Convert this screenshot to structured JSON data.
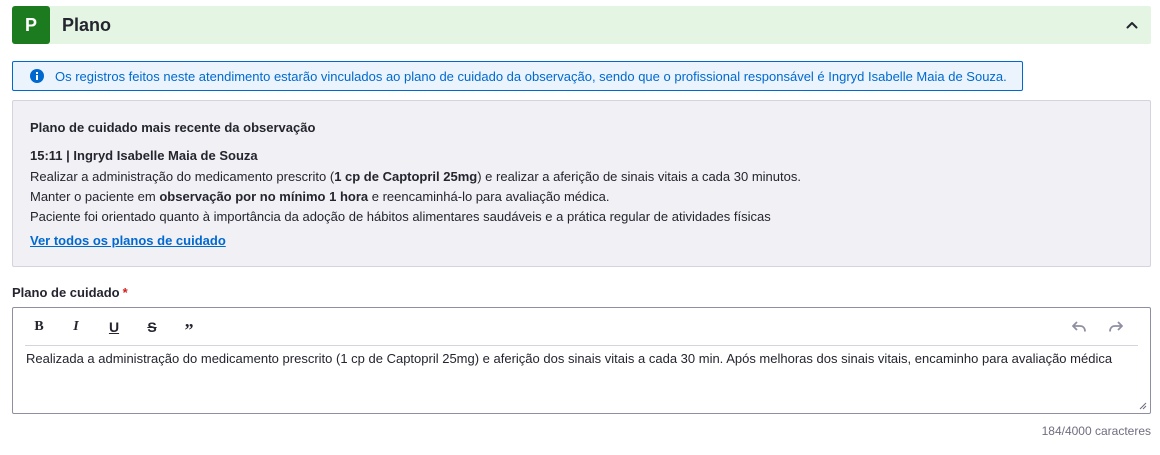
{
  "section": {
    "badge": "P",
    "title": "Plano",
    "collapse_icon": "chevron-up-icon",
    "badge_color": "#1d7b1f",
    "header_bg": "#e4f5e4"
  },
  "alert": {
    "icon": "info-icon",
    "text": "Os registros feitos neste atendimento estarão vinculados ao plano de cuidado da observação, sendo que o profissional responsável é Ingryd Isabelle Maia de Souza.",
    "color": "#0069d0"
  },
  "recent_plan": {
    "heading": "Plano de cuidado mais recente da observação",
    "entry_header": "15:11 | Ingryd Isabelle Maia de Souza",
    "line1": {
      "pre": "Realizar a administração do medicamento prescrito (",
      "bold": "1 cp de Captopril 25mg",
      "post": ") e realizar a aferição de sinais vitais a cada 30 minutos."
    },
    "line2": {
      "pre": "Manter o paciente em ",
      "bold": "observação por no mínimo 1 hora",
      "post": " e reencaminhá-lo para avaliação médica."
    },
    "line3": "Paciente foi orientado quanto à importância da adoção de hábitos alimentares saudáveis e a prática regular de atividades físicas",
    "see_all_link": "Ver todos os planos de cuidado"
  },
  "field": {
    "label": "Plano de cuidado",
    "required_mark": "*"
  },
  "editor": {
    "toolbar": {
      "bold": "B",
      "italic": "I",
      "underline": "U",
      "strike": "S",
      "quote": "”",
      "undo_icon": "undo-icon",
      "redo_icon": "redo-icon"
    },
    "content": "Realizada a administração do medicamento prescrito (1 cp de Captopril 25mg) e aferição dos sinais vitais a cada 30 min. Após melhoras dos sinais vitais, encaminho para avaliação médica"
  },
  "char_count": "184/4000 caracteres"
}
